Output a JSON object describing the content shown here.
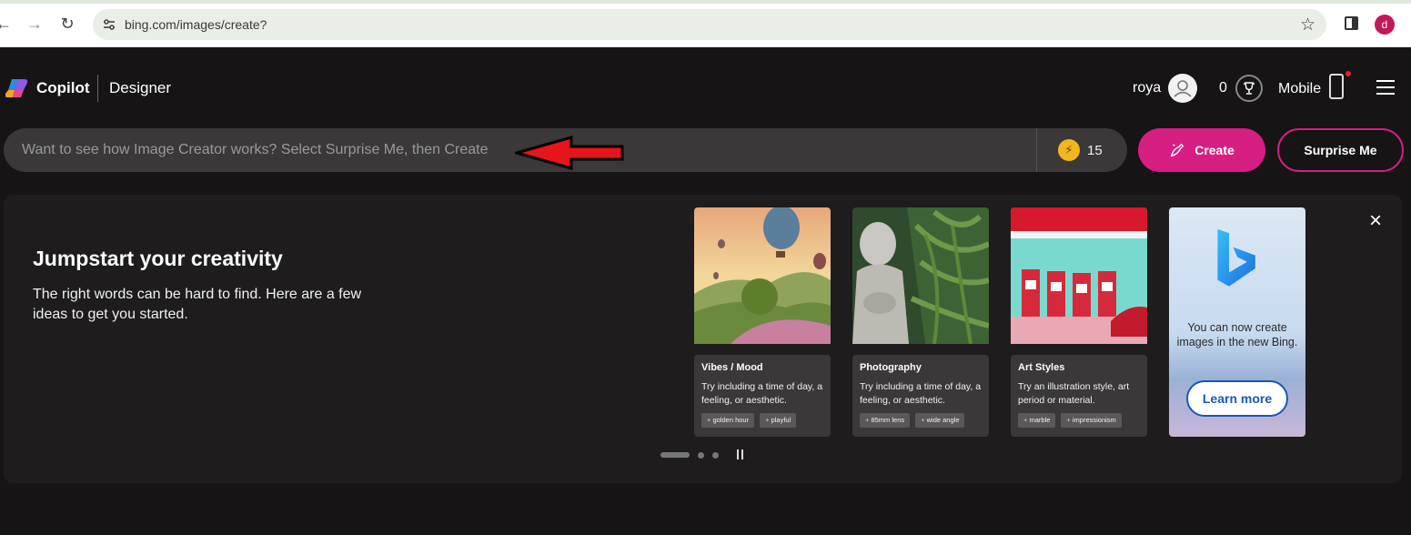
{
  "browser": {
    "url": "bing.com/images/create?",
    "profile_initial": "d"
  },
  "header": {
    "brand": "Copilot",
    "section": "Designer",
    "username": "roya",
    "points": "0",
    "mobile_label": "Mobile"
  },
  "search": {
    "placeholder": "Want to see how Image Creator works? Select Surprise Me, then Create",
    "boost_count": "15"
  },
  "buttons": {
    "create": "Create",
    "surprise": "Surprise Me"
  },
  "panel": {
    "title": "Jumpstart your creativity",
    "description": "The right words can be hard to find. Here are a few ideas to get you started.",
    "cards": [
      {
        "title": "Vibes / Mood",
        "text": "Try including a time of day, a feeling, or aesthetic.",
        "chips": [
          "golden hour",
          "playful"
        ]
      },
      {
        "title": "Photography",
        "text": "Try including a time of day, a feeling, or aesthetic.",
        "chips": [
          "85mm lens",
          "wide angle"
        ]
      },
      {
        "title": "Art Styles",
        "text": "Try an illustration style, art period or material.",
        "chips": [
          "marble",
          "impressionism"
        ]
      }
    ],
    "promo": {
      "text": "You can now create images in the new Bing.",
      "button": "Learn more"
    }
  },
  "colors": {
    "accent": "#d61e83",
    "background": "#161414",
    "panel": "#1e1c1c",
    "learn_more": "#1a56b8"
  },
  "icons": [
    "back-icon",
    "forward-icon",
    "reload-icon",
    "site-settings-icon",
    "star-icon",
    "side-panel-icon",
    "copilot-logo",
    "avatar-icon",
    "trophy-icon",
    "phone-icon",
    "menu-icon",
    "boost-icon",
    "create-icon",
    "close-icon",
    "pause-icon",
    "bing-logo"
  ]
}
